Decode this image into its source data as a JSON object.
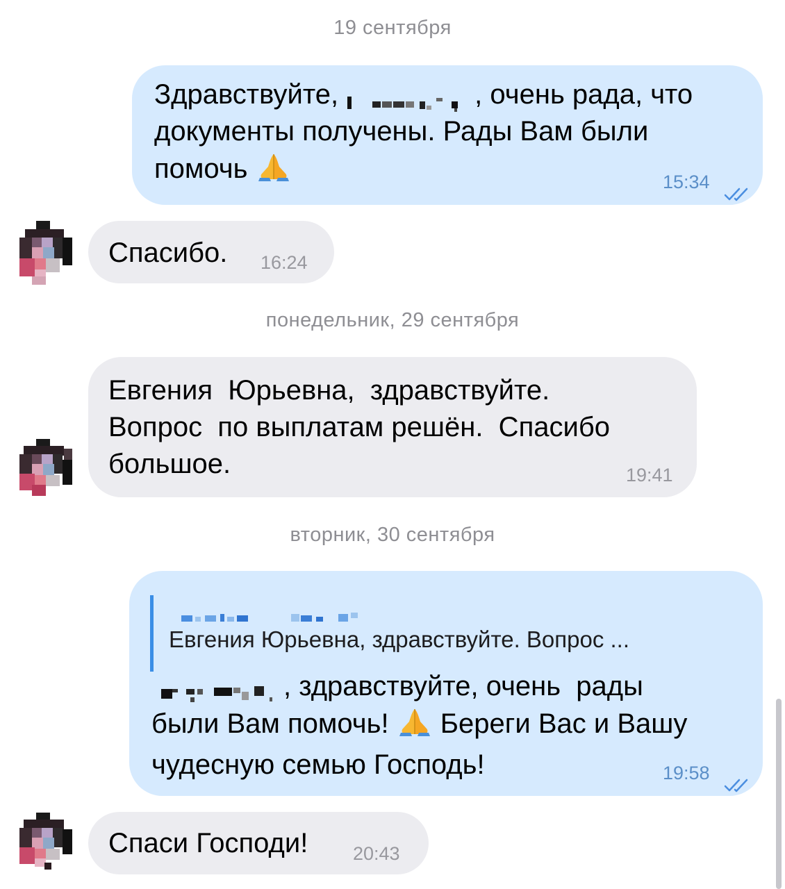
{
  "date_separators": {
    "d1": "19 сентября",
    "d2": "понедельник, 29 сентября",
    "d3": "вторник, 30 сентября"
  },
  "messages": [
    {
      "direction": "out",
      "text_before": "Здравствуйте, ",
      "text_after": ", очень рада, что",
      "line2": "документы получены. Рады Вам были",
      "line3": "помочь",
      "emoji": "folded-hands",
      "time": "15:34",
      "status": "read"
    },
    {
      "direction": "in",
      "text": "Спасибо.",
      "time": "16:24"
    },
    {
      "direction": "in",
      "line1": "Евгения  Юрьевна,  здравствуйте.",
      "line2": "Вопрос  по выплатам решён.  Спасибо",
      "line3": "большое.",
      "time": "19:41"
    },
    {
      "direction": "out",
      "reply_quote": "Евгения Юрьевна, здравствуйте. Вопрос ...",
      "line1_after": ", здравствуйте, очень  рады",
      "line2_before": "были Вам помочь! ",
      "line2_after": " Береги Вас и Вашу",
      "line3": "чудесную семью Господь!",
      "emoji": "folded-hands",
      "time": "19:58",
      "status": "read"
    },
    {
      "direction": "in",
      "text": "Спаси Господи!",
      "time": "20:43"
    }
  ],
  "colors": {
    "outgoing_bubble": "#d6eafe",
    "incoming_bubble": "#ececf0",
    "accent": "#3a8ee6",
    "date_text": "#8e8e93"
  }
}
